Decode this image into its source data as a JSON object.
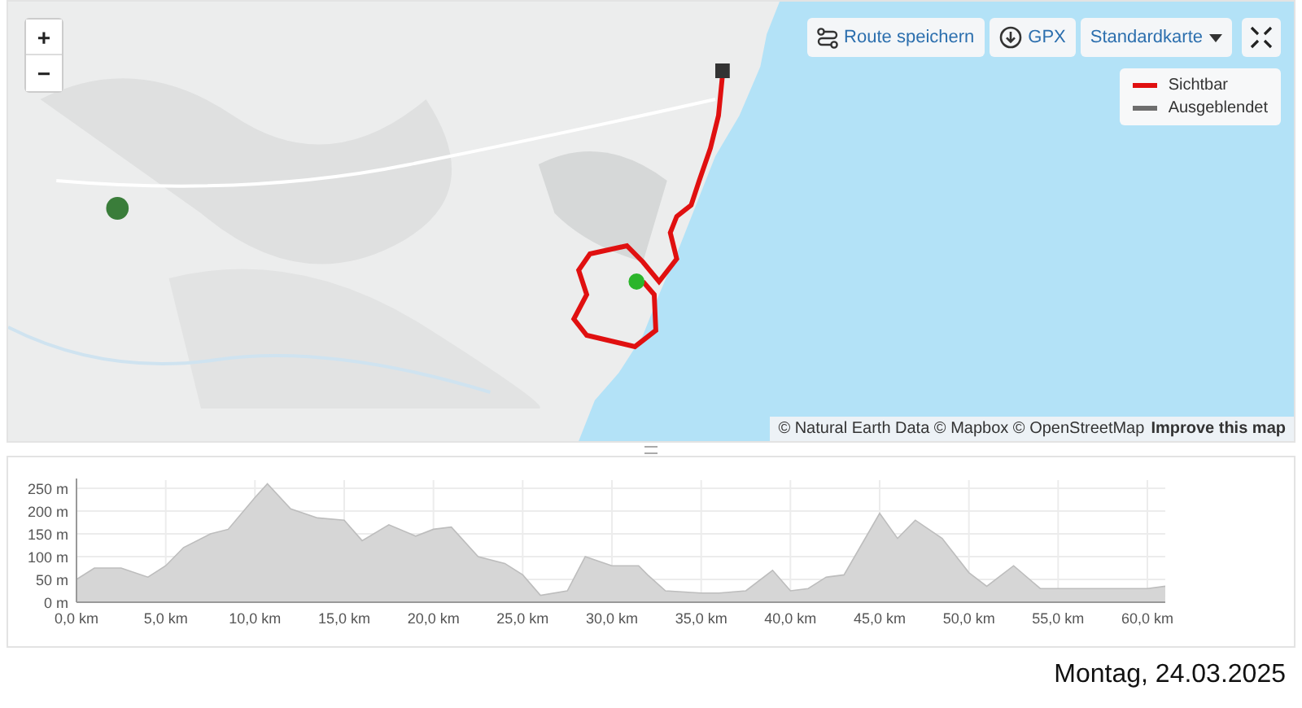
{
  "map": {
    "zoom_in": "+",
    "zoom_out": "−",
    "buttons": [
      {
        "kind": "save",
        "label": "Route speichern"
      },
      {
        "kind": "download",
        "label": "GPX"
      },
      {
        "kind": "dropdown",
        "label": "Standardkarte"
      },
      {
        "kind": "fullscreen"
      }
    ],
    "legend": [
      {
        "label": "Sichtbar",
        "color": "#e01010"
      },
      {
        "label": "Ausgeblendet",
        "color": "#6e6e6e"
      }
    ],
    "attribution": "© Natural Earth Data © Mapbox © OpenStreetMap",
    "attribution_link": "Improve this map"
  },
  "elevation": {
    "chart_data": {
      "type": "area",
      "xlim": [
        0,
        61
      ],
      "ylim": [
        0,
        270
      ],
      "x": [
        0,
        1,
        2.5,
        4,
        5,
        6,
        7.5,
        8.5,
        10,
        10.7,
        12,
        13.5,
        15,
        16,
        17.5,
        19,
        20,
        21,
        22.5,
        24,
        25,
        26,
        27.5,
        28.5,
        30,
        31.5,
        32,
        33,
        35,
        36,
        37.5,
        39,
        40,
        41,
        42,
        43,
        45,
        46,
        47,
        48.5,
        50,
        51,
        52.5,
        54,
        55,
        57.5,
        60,
        61
      ],
      "grid": true,
      "series": [
        {
          "color": "#d6d6d6",
          "values": [
            50,
            75,
            75,
            55,
            80,
            120,
            150,
            160,
            230,
            260,
            205,
            185,
            180,
            135,
            170,
            145,
            160,
            165,
            100,
            85,
            60,
            15,
            25,
            100,
            80,
            80,
            60,
            25,
            20,
            20,
            25,
            70,
            25,
            30,
            55,
            60,
            195,
            140,
            180,
            140,
            65,
            35,
            80,
            30,
            30,
            30,
            30,
            35
          ]
        }
      ],
      "xticks": [
        {
          "value": 0,
          "label": "0,0 km"
        },
        {
          "value": 5,
          "label": "5,0 km"
        },
        {
          "value": 10,
          "label": "10,0 km"
        },
        {
          "value": 15,
          "label": "15,0 km"
        },
        {
          "value": 20,
          "label": "20,0 km"
        },
        {
          "value": 25,
          "label": "25,0 km"
        },
        {
          "value": 30,
          "label": "30,0 km"
        },
        {
          "value": 35,
          "label": "35,0 km"
        },
        {
          "value": 40,
          "label": "40,0 km"
        },
        {
          "value": 45,
          "label": "45,0 km"
        },
        {
          "value": 50,
          "label": "50,0 km"
        },
        {
          "value": 55,
          "label": "55,0 km"
        },
        {
          "value": 60,
          "label": "60,0 km"
        }
      ],
      "yticks": [
        {
          "value": 0,
          "label": "0 m"
        },
        {
          "value": 50,
          "label": "50 m"
        },
        {
          "value": 100,
          "label": "100 m"
        },
        {
          "value": 150,
          "label": "150 m"
        },
        {
          "value": 200,
          "label": "200 m"
        },
        {
          "value": 250,
          "label": "250 m"
        }
      ]
    }
  },
  "date": "Montag, 24.03.2025"
}
